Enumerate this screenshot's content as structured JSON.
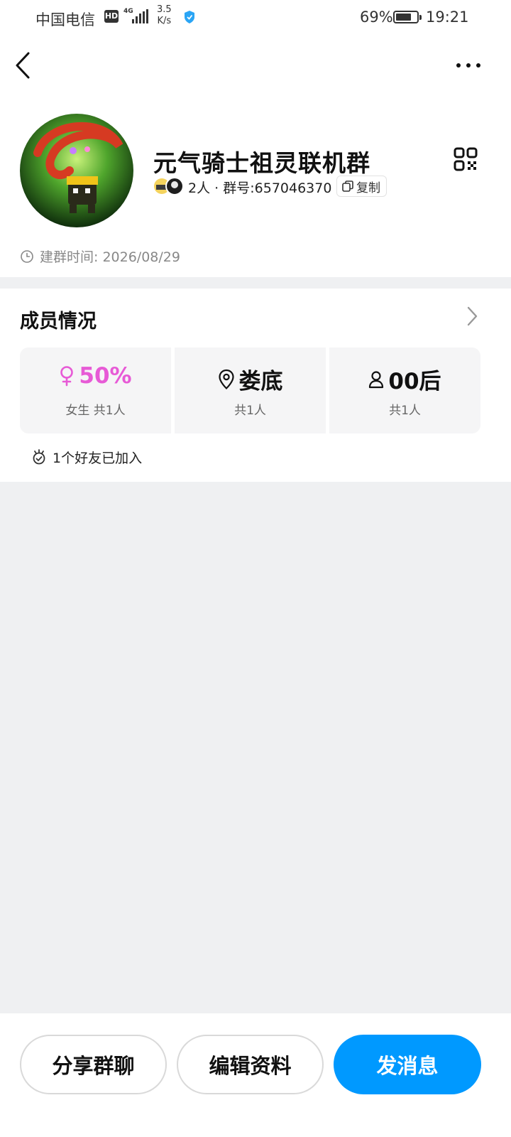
{
  "status_bar": {
    "carrier": "中国电信",
    "hd_badge": "HD",
    "network": "4G",
    "speed_value": "3.5",
    "speed_unit": "K/s",
    "battery_percent": "69%",
    "time": "19:21"
  },
  "nav": {
    "back_icon": "chevron-left-icon",
    "more_icon": "more-horizontal-icon"
  },
  "group": {
    "name": "元气骑士祖灵联机群",
    "member_count": "2人",
    "separator": "·",
    "group_number": "群号:657046370",
    "copy_label": "复制",
    "created_label": "建群时间: 2026/08/29"
  },
  "members": {
    "title": "成员情况",
    "stats": [
      {
        "icon": "female-icon",
        "value": "50%",
        "label": "女生 共1人",
        "accent": "#e75ad6"
      },
      {
        "icon": "location-pin-icon",
        "value": "娄底",
        "label": "共1人"
      },
      {
        "icon": "person-icon",
        "value": "00后",
        "label": "共1人"
      }
    ],
    "friend_joined": "1个好友已加入"
  },
  "actions": {
    "share_label": "分享群聊",
    "edit_label": "编辑资料",
    "send_label": "发消息",
    "send_color": "#0099ff"
  }
}
